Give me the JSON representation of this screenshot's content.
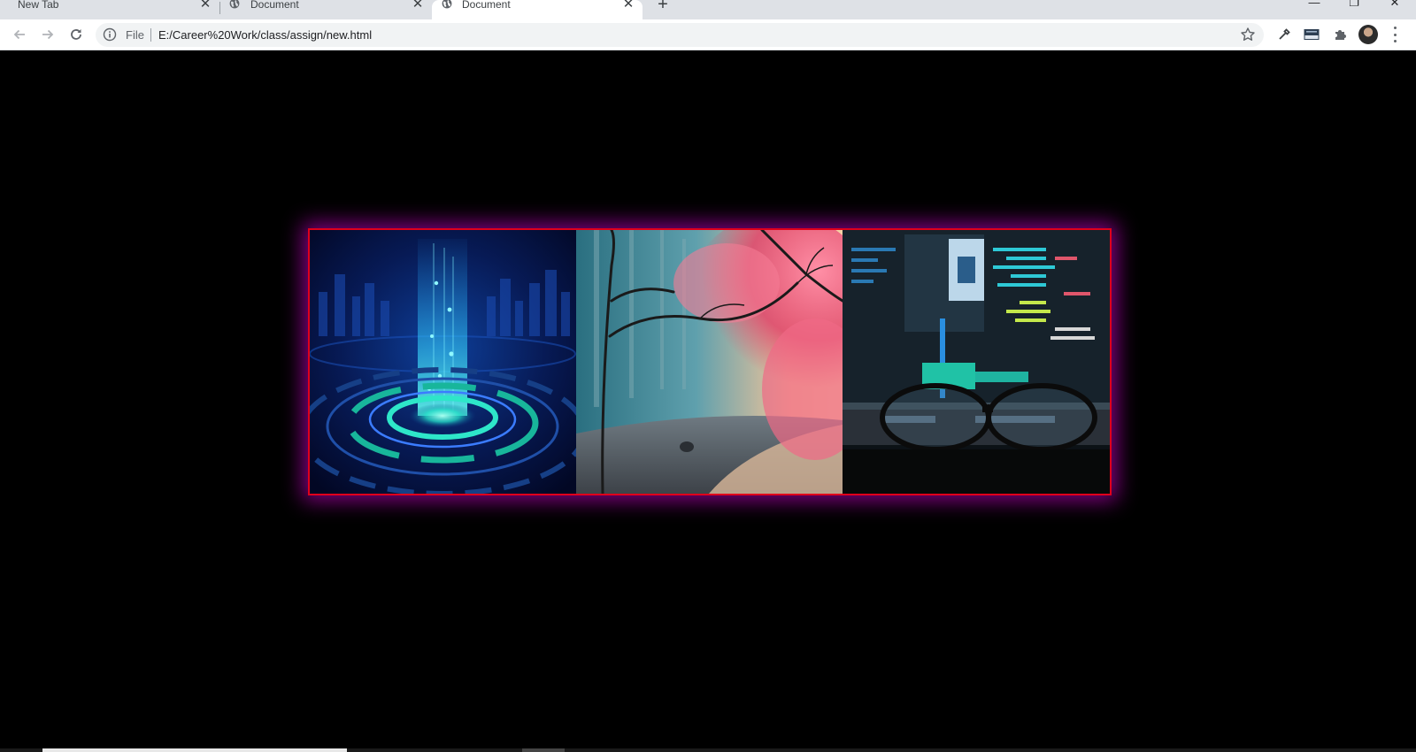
{
  "browser": {
    "tabs": [
      {
        "title": "New Tab",
        "active": false
      },
      {
        "title": "Document",
        "active": false
      },
      {
        "title": "Document",
        "active": true
      }
    ],
    "new_tab_symbol": "+",
    "address": {
      "scheme_label": "File",
      "url": "E:/Career%20Work/class/assign/new.html"
    },
    "icons": {
      "back": "arrow-left-icon",
      "forward": "arrow-right-icon",
      "reload": "reload-icon",
      "info": "info-icon",
      "bookmark": "star-icon",
      "extension1": "eyedropper-icon",
      "extension2": "new-badge-icon",
      "extensions": "puzzle-icon",
      "profile": "avatar-icon",
      "menu": "more-vert-icon"
    },
    "window_controls": [
      "minimize",
      "restore",
      "close"
    ]
  },
  "page": {
    "background": "#000000",
    "gallery": {
      "border_color": "#e0001b",
      "glow_color": "#aa00aa",
      "images": [
        {
          "subject": "hologram portal"
        },
        {
          "subject": "pink tree forest"
        },
        {
          "subject": "code on monitor with glasses"
        }
      ]
    }
  }
}
